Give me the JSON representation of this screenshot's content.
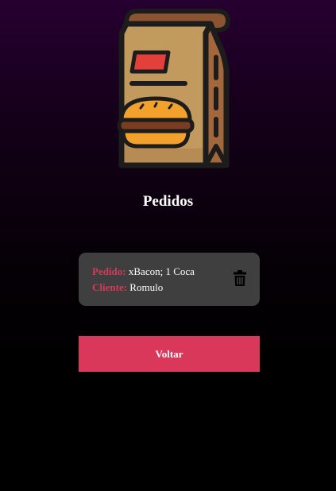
{
  "page": {
    "title": "Pedidos"
  },
  "order": {
    "pedido_label": "Pedido:",
    "pedido_value": "xBacon; 1 Coca",
    "cliente_label": "Cliente:",
    "cliente_value": "Romulo",
    "delete_icon": "trash-icon"
  },
  "actions": {
    "back_label": "Voltar"
  },
  "colors": {
    "accent": "#d9385a",
    "label": "#d43a5a",
    "card": "#3f3f3f",
    "bg_top": "#260030"
  },
  "logo": {
    "icon": "burger-bag-icon"
  }
}
